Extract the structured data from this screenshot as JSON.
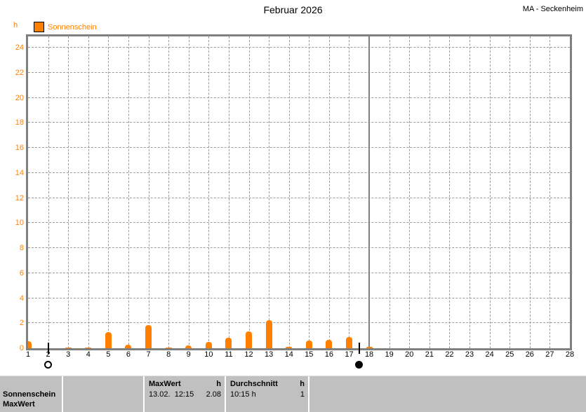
{
  "header": {
    "title": "Februar 2026",
    "station": "MA - Seckenheim"
  },
  "legend": {
    "unit_label": "h",
    "series_label": "Sonnenschein"
  },
  "colors": {
    "series": "#FF8000",
    "grid": "#9C9C9C",
    "frame": "#808080",
    "now_line": "#808080",
    "panel_bg": "#C0C0C0",
    "y_axis_label": "#FF8000",
    "x_axis_label": "#000000"
  },
  "chart_data": {
    "type": "bar",
    "title": "Februar 2026",
    "station": "MA - Seckenheim",
    "series_name": "Sonnenschein",
    "unit": "h",
    "day_labels": [
      1,
      2,
      3,
      4,
      5,
      6,
      7,
      8,
      9,
      10,
      11,
      12,
      13,
      14,
      15,
      16,
      17,
      18,
      19,
      20,
      21,
      22,
      23,
      24,
      25,
      26,
      27,
      28
    ],
    "values": [
      0.55,
      0,
      0.08,
      0.06,
      1.3,
      0.3,
      1.85,
      0.08,
      0.25,
      0.5,
      0.85,
      1.35,
      2.25,
      0.1,
      0.6,
      0.65,
      0.9,
      0.1,
      0,
      0,
      0,
      0,
      0,
      0,
      0,
      0,
      0,
      0
    ],
    "ylim": [
      0,
      24.9
    ],
    "yticks": [
      0,
      2,
      4,
      6,
      8,
      10,
      12,
      14,
      16,
      18,
      20,
      22,
      24
    ],
    "grid": true,
    "legend_position": "top-left",
    "now_line_day": 18,
    "moon_markers": [
      {
        "day": 2,
        "phase": "full-moon"
      },
      {
        "day": 17.5,
        "phase": "new-moon"
      }
    ]
  },
  "summary_panel": {
    "row_label_line1": "Sonnenschein",
    "row_label_line2": "MaxWert",
    "columns": [
      {
        "header": "MaxWert",
        "unit": "h",
        "value_left": "13.02.  12:15",
        "value_right": "2.08"
      },
      {
        "header": "Durchschnitt",
        "unit": "h",
        "value_left": "10:15 h",
        "value_right": "1"
      }
    ]
  }
}
